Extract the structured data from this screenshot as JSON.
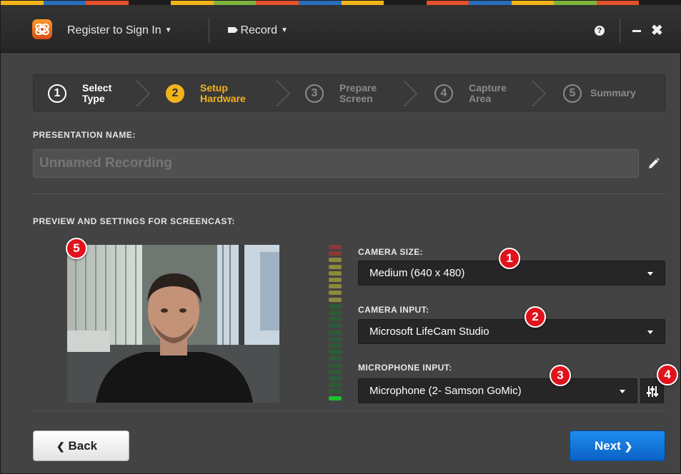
{
  "titlebar": {
    "register_label": "Register to Sign In",
    "record_label": "Record",
    "help_icon": "question-circle-icon",
    "minimize_icon": "minimize-icon",
    "close_icon": "close-icon"
  },
  "stripe_colors": [
    "#f4b41a",
    "#2a6ebb",
    "#e5512a",
    "#1c1c1c",
    "#f4b41a",
    "#7fb33e",
    "#e5512a",
    "#2a6ebb",
    "#f4b41a",
    "#1c1c1c",
    "#e5512a",
    "#2a6ebb",
    "#f4b41a",
    "#7fb33e",
    "#e5512a",
    "#1c1c1c"
  ],
  "steps": [
    {
      "num": "1",
      "line1": "Select",
      "line2": "Type",
      "state": "done"
    },
    {
      "num": "2",
      "line1": "Setup",
      "line2": "Hardware",
      "state": "active"
    },
    {
      "num": "3",
      "line1": "Prepare",
      "line2": "Screen",
      "state": "pending"
    },
    {
      "num": "4",
      "line1": "Capture",
      "line2": "Area",
      "state": "pending"
    },
    {
      "num": "5",
      "line1": "Summary",
      "line2": "",
      "state": "pending"
    }
  ],
  "presentation": {
    "label": "PRESENTATION NAME:",
    "placeholder": "Unnamed Recording"
  },
  "preview": {
    "label": "PREVIEW AND SETTINGS FOR SCREENCAST:"
  },
  "settings": {
    "camera_size_label": "CAMERA SIZE:",
    "camera_size_value": "Medium (640 x 480)",
    "camera_input_label": "CAMERA INPUT:",
    "camera_input_value": "Microsoft LifeCam Studio",
    "mic_input_label": "MICROPHONE INPUT:",
    "mic_input_value": "Microphone (2- Samson GoMic)"
  },
  "callouts": [
    "1",
    "2",
    "3",
    "4",
    "5"
  ],
  "audio_level": 0.05,
  "buttons": {
    "back_label": "Back",
    "next_label": "Next"
  },
  "colors": {
    "accent_active": "#f3b31b",
    "next_button": "#1577dc",
    "callout": "#e0121b"
  }
}
